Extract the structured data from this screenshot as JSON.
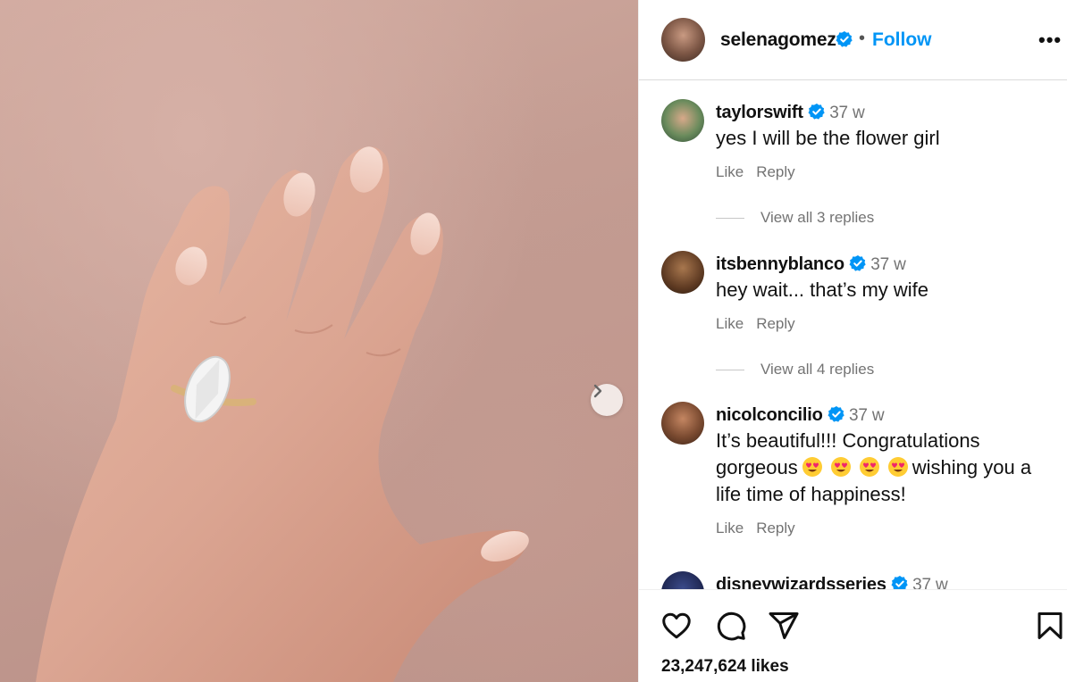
{
  "post": {
    "username": "selenagomez",
    "follow_label": "Follow",
    "separator": "•",
    "more_label": "•••"
  },
  "comments": [
    {
      "username": "taylorswift",
      "time": "37 w",
      "text": "yes I will be the flower girl",
      "like": "Like",
      "reply": "Reply",
      "view_replies": "View all 3 replies"
    },
    {
      "username": "itsbennyblanco",
      "time": "37 w",
      "text": "hey wait... that’s my wife",
      "like": "Like",
      "reply": "Reply",
      "view_replies": "View all 4 replies"
    },
    {
      "username": "nicolconcilio",
      "time": "37 w",
      "text_part1": "It’s beautiful!!! Congratulations gorgeous",
      "text_part2": "wishing you a life time of happiness!",
      "like": "Like",
      "reply": "Reply"
    },
    {
      "username": "disneywizardsseries",
      "time": "37 w"
    }
  ],
  "footer": {
    "likes": "23,247,624 likes"
  },
  "icons": {
    "like": "heart-icon",
    "comment": "comment-icon",
    "share": "send-icon",
    "save": "bookmark-icon",
    "next": "chevron-right-icon",
    "verified": "verified-badge-icon",
    "emoji": "heart-eyes-emoji"
  },
  "colors": {
    "accent": "#0095f6",
    "verified": "#0095f6",
    "muted": "#737373"
  }
}
